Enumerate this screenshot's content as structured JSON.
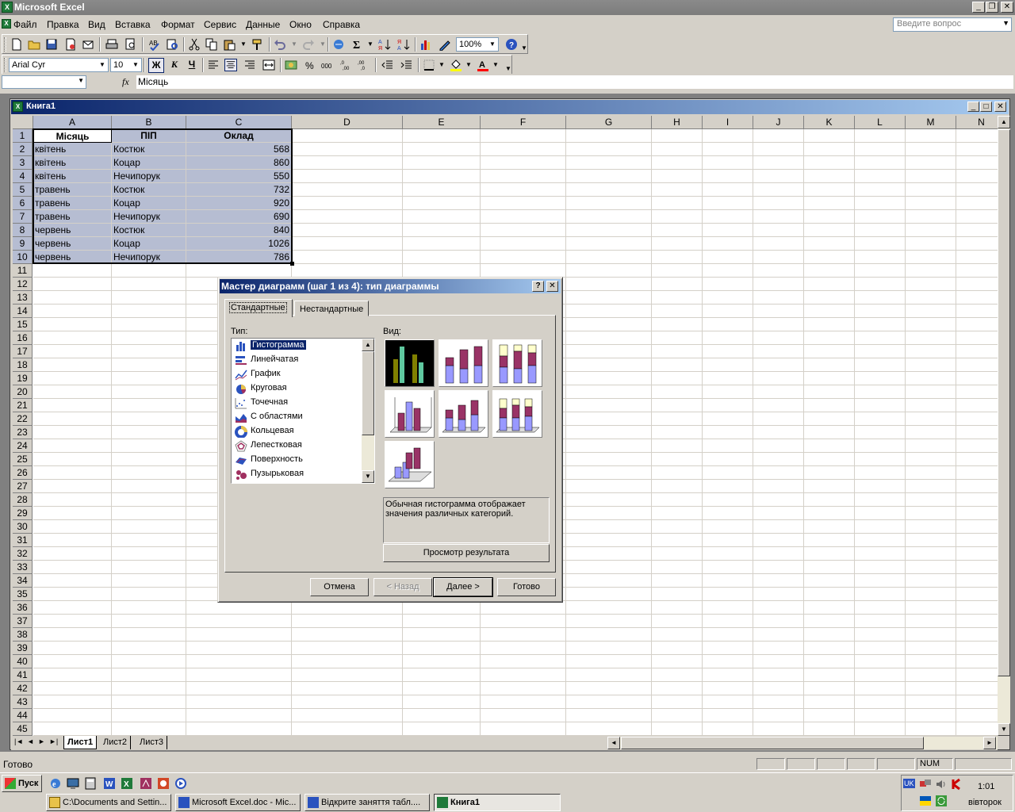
{
  "app": {
    "title": "Microsoft Excel",
    "icon": "excel-icon"
  },
  "menu": [
    "Файл",
    "Правка",
    "Вид",
    "Вставка",
    "Формат",
    "Сервис",
    "Данные",
    "Окно",
    "Справка"
  ],
  "ask_placeholder": "Введите вопрос",
  "toolbar": {
    "zoom": "100%",
    "font": "Arial Cyr",
    "size": "10",
    "bold": "Ж",
    "italic": "К",
    "underline": "Ч"
  },
  "formula_bar": {
    "fx": "fx",
    "value": "Місяць"
  },
  "workbook": {
    "title": "Книга1"
  },
  "columns": [
    "A",
    "B",
    "C",
    "D",
    "E",
    "F",
    "G",
    "H",
    "I",
    "J",
    "K",
    "L",
    "M",
    "N"
  ],
  "header_row": [
    "Місяць",
    "ПІП",
    "Оклад"
  ],
  "rows": [
    [
      "квітень",
      "Костюк",
      "568"
    ],
    [
      "квітень",
      "Коцар",
      "860"
    ],
    [
      "квітень",
      "Нечипорук",
      "550"
    ],
    [
      "травень",
      "Костюк",
      "732"
    ],
    [
      "травень",
      "Коцар",
      "920"
    ],
    [
      "травень",
      "Нечипорук",
      "690"
    ],
    [
      "червень",
      "Костюк",
      "840"
    ],
    [
      "червень",
      "Коцар",
      "1026"
    ],
    [
      "червень",
      "Нечипорук",
      "786"
    ]
  ],
  "sheets": [
    "Лист1",
    "Лист2",
    "Лист3"
  ],
  "status": {
    "left": "Готово",
    "num": "NUM"
  },
  "dialog": {
    "title": "Мастер диаграмм (шаг 1 из 4): тип диаграммы",
    "help": "?",
    "tabs": [
      "Стандартные",
      "Нестандартные"
    ],
    "type_label": "Тип:",
    "view_label": "Вид:",
    "types": [
      "Гистограмма",
      "Линейчатая",
      "График",
      "Круговая",
      "Точечная",
      "С областями",
      "Кольцевая",
      "Лепестковая",
      "Поверхность",
      "Пузырьковая"
    ],
    "description": "Обычная гистограмма отображает значения различных категорий.",
    "preview_button": "Просмотр результата",
    "buttons": {
      "cancel": "Отмена",
      "back": "< Назад",
      "next": "Далее >",
      "finish": "Готово"
    }
  },
  "taskbar": {
    "start": "Пуск",
    "tasks": [
      "C:\\Documents and Settin...",
      "Microsoft Excel.doc - Mic...",
      "Відкрите заняття табл....",
      "Книга1"
    ],
    "lang": "UK",
    "time": "1:01",
    "day": "вівторок"
  }
}
